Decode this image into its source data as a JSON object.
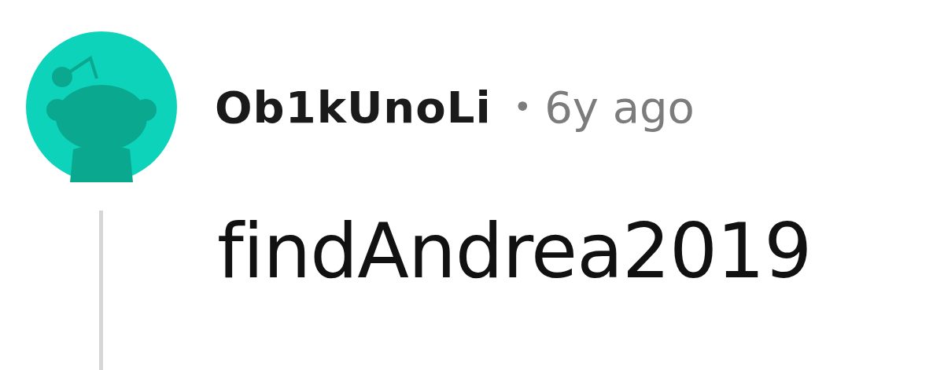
{
  "comment": {
    "author": "Ob1kUnoLi",
    "separator": "•",
    "time": "6y ago",
    "body": "findAndrea2019"
  }
}
